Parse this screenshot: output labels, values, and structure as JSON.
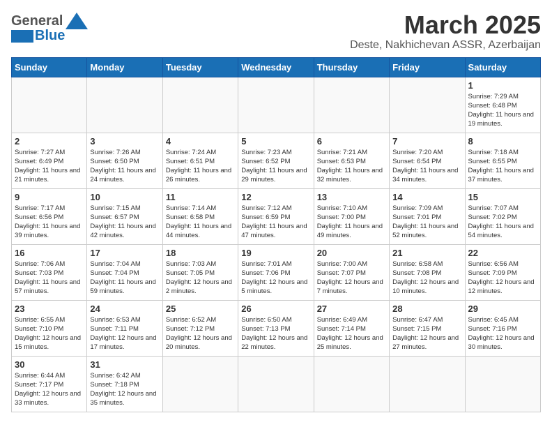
{
  "header": {
    "logo_general": "General",
    "logo_blue": "Blue",
    "title": "March 2025",
    "subtitle": "Deste, Nakhichevan ASSR, Azerbaijan"
  },
  "days_of_week": [
    "Sunday",
    "Monday",
    "Tuesday",
    "Wednesday",
    "Thursday",
    "Friday",
    "Saturday"
  ],
  "weeks": [
    [
      {
        "day": "",
        "info": ""
      },
      {
        "day": "",
        "info": ""
      },
      {
        "day": "",
        "info": ""
      },
      {
        "day": "",
        "info": ""
      },
      {
        "day": "",
        "info": ""
      },
      {
        "day": "",
        "info": ""
      },
      {
        "day": "1",
        "info": "Sunrise: 7:29 AM\nSunset: 6:48 PM\nDaylight: 11 hours and 19 minutes."
      }
    ],
    [
      {
        "day": "2",
        "info": "Sunrise: 7:27 AM\nSunset: 6:49 PM\nDaylight: 11 hours and 21 minutes."
      },
      {
        "day": "3",
        "info": "Sunrise: 7:26 AM\nSunset: 6:50 PM\nDaylight: 11 hours and 24 minutes."
      },
      {
        "day": "4",
        "info": "Sunrise: 7:24 AM\nSunset: 6:51 PM\nDaylight: 11 hours and 26 minutes."
      },
      {
        "day": "5",
        "info": "Sunrise: 7:23 AM\nSunset: 6:52 PM\nDaylight: 11 hours and 29 minutes."
      },
      {
        "day": "6",
        "info": "Sunrise: 7:21 AM\nSunset: 6:53 PM\nDaylight: 11 hours and 32 minutes."
      },
      {
        "day": "7",
        "info": "Sunrise: 7:20 AM\nSunset: 6:54 PM\nDaylight: 11 hours and 34 minutes."
      },
      {
        "day": "8",
        "info": "Sunrise: 7:18 AM\nSunset: 6:55 PM\nDaylight: 11 hours and 37 minutes."
      }
    ],
    [
      {
        "day": "9",
        "info": "Sunrise: 7:17 AM\nSunset: 6:56 PM\nDaylight: 11 hours and 39 minutes."
      },
      {
        "day": "10",
        "info": "Sunrise: 7:15 AM\nSunset: 6:57 PM\nDaylight: 11 hours and 42 minutes."
      },
      {
        "day": "11",
        "info": "Sunrise: 7:14 AM\nSunset: 6:58 PM\nDaylight: 11 hours and 44 minutes."
      },
      {
        "day": "12",
        "info": "Sunrise: 7:12 AM\nSunset: 6:59 PM\nDaylight: 11 hours and 47 minutes."
      },
      {
        "day": "13",
        "info": "Sunrise: 7:10 AM\nSunset: 7:00 PM\nDaylight: 11 hours and 49 minutes."
      },
      {
        "day": "14",
        "info": "Sunrise: 7:09 AM\nSunset: 7:01 PM\nDaylight: 11 hours and 52 minutes."
      },
      {
        "day": "15",
        "info": "Sunrise: 7:07 AM\nSunset: 7:02 PM\nDaylight: 11 hours and 54 minutes."
      }
    ],
    [
      {
        "day": "16",
        "info": "Sunrise: 7:06 AM\nSunset: 7:03 PM\nDaylight: 11 hours and 57 minutes."
      },
      {
        "day": "17",
        "info": "Sunrise: 7:04 AM\nSunset: 7:04 PM\nDaylight: 11 hours and 59 minutes."
      },
      {
        "day": "18",
        "info": "Sunrise: 7:03 AM\nSunset: 7:05 PM\nDaylight: 12 hours and 2 minutes."
      },
      {
        "day": "19",
        "info": "Sunrise: 7:01 AM\nSunset: 7:06 PM\nDaylight: 12 hours and 5 minutes."
      },
      {
        "day": "20",
        "info": "Sunrise: 7:00 AM\nSunset: 7:07 PM\nDaylight: 12 hours and 7 minutes."
      },
      {
        "day": "21",
        "info": "Sunrise: 6:58 AM\nSunset: 7:08 PM\nDaylight: 12 hours and 10 minutes."
      },
      {
        "day": "22",
        "info": "Sunrise: 6:56 AM\nSunset: 7:09 PM\nDaylight: 12 hours and 12 minutes."
      }
    ],
    [
      {
        "day": "23",
        "info": "Sunrise: 6:55 AM\nSunset: 7:10 PM\nDaylight: 12 hours and 15 minutes."
      },
      {
        "day": "24",
        "info": "Sunrise: 6:53 AM\nSunset: 7:11 PM\nDaylight: 12 hours and 17 minutes."
      },
      {
        "day": "25",
        "info": "Sunrise: 6:52 AM\nSunset: 7:12 PM\nDaylight: 12 hours and 20 minutes."
      },
      {
        "day": "26",
        "info": "Sunrise: 6:50 AM\nSunset: 7:13 PM\nDaylight: 12 hours and 22 minutes."
      },
      {
        "day": "27",
        "info": "Sunrise: 6:49 AM\nSunset: 7:14 PM\nDaylight: 12 hours and 25 minutes."
      },
      {
        "day": "28",
        "info": "Sunrise: 6:47 AM\nSunset: 7:15 PM\nDaylight: 12 hours and 27 minutes."
      },
      {
        "day": "29",
        "info": "Sunrise: 6:45 AM\nSunset: 7:16 PM\nDaylight: 12 hours and 30 minutes."
      }
    ],
    [
      {
        "day": "30",
        "info": "Sunrise: 6:44 AM\nSunset: 7:17 PM\nDaylight: 12 hours and 33 minutes."
      },
      {
        "day": "31",
        "info": "Sunrise: 6:42 AM\nSunset: 7:18 PM\nDaylight: 12 hours and 35 minutes."
      },
      {
        "day": "",
        "info": ""
      },
      {
        "day": "",
        "info": ""
      },
      {
        "day": "",
        "info": ""
      },
      {
        "day": "",
        "info": ""
      },
      {
        "day": "",
        "info": ""
      }
    ]
  ]
}
